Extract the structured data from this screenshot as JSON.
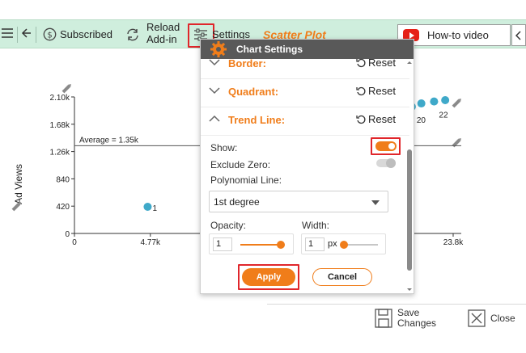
{
  "toolbar": {
    "subscribed_label": "Subscribed",
    "reload_line1": "Reload",
    "reload_line2": "Add-in",
    "settings_label": "Settings",
    "chart_title": "Scatter Plot",
    "howto_label": "How-to video"
  },
  "panel": {
    "title": "Chart Settings",
    "sections": [
      {
        "label": "Border:",
        "reset": "Reset",
        "expanded": false
      },
      {
        "label": "Quadrant:",
        "reset": "Reset",
        "expanded": false
      },
      {
        "label": "Trend Line:",
        "reset": "Reset",
        "expanded": true
      }
    ],
    "show_label": "Show:",
    "show_on": true,
    "exclude_zero_label": "Exclude Zero:",
    "exclude_zero_on": false,
    "polynomial_label": "Polynomial Line:",
    "polynomial_value": "1st degree",
    "opacity_label": "Opacity:",
    "opacity_value": "1",
    "opacity_fraction": 0.9,
    "width_label": "Width:",
    "width_value": "1",
    "width_unit": "px",
    "width_fraction": 0.05,
    "apply_label": "Apply",
    "cancel_label": "Cancel"
  },
  "footer": {
    "save_line1": "Save",
    "save_line2": "Changes",
    "close_label": "Close"
  },
  "chart_data": {
    "type": "scatter",
    "ylabel": "Ad Views",
    "y_ticks": [
      "0",
      "420",
      "840",
      "1.26k",
      "1.68k",
      "2.10k"
    ],
    "y_tick_values": [
      0,
      420,
      840,
      1260,
      1680,
      2100
    ],
    "x_ticks": [
      "0",
      "4.77k",
      "23.8k"
    ],
    "x_tick_values": [
      0,
      4770,
      23800
    ],
    "xlim": [
      0,
      23800
    ],
    "ylim": [
      0,
      2100
    ],
    "average_line": {
      "label": "Average = 1.35k",
      "value": 1350
    },
    "points": [
      {
        "x": 4600,
        "y": 410,
        "label": "1"
      },
      {
        "x": 21200,
        "y": 1950,
        "label": "20"
      },
      {
        "x": 21800,
        "y": 2000,
        "label": ""
      },
      {
        "x": 22600,
        "y": 2030,
        "label": "22"
      },
      {
        "x": 23300,
        "y": 2050,
        "label": ""
      }
    ],
    "point_color": "#3fa9c9"
  },
  "colors": {
    "accent": "#f07d1a",
    "toolbar_bg": "#cfeedd",
    "highlight": "#e0262b"
  }
}
